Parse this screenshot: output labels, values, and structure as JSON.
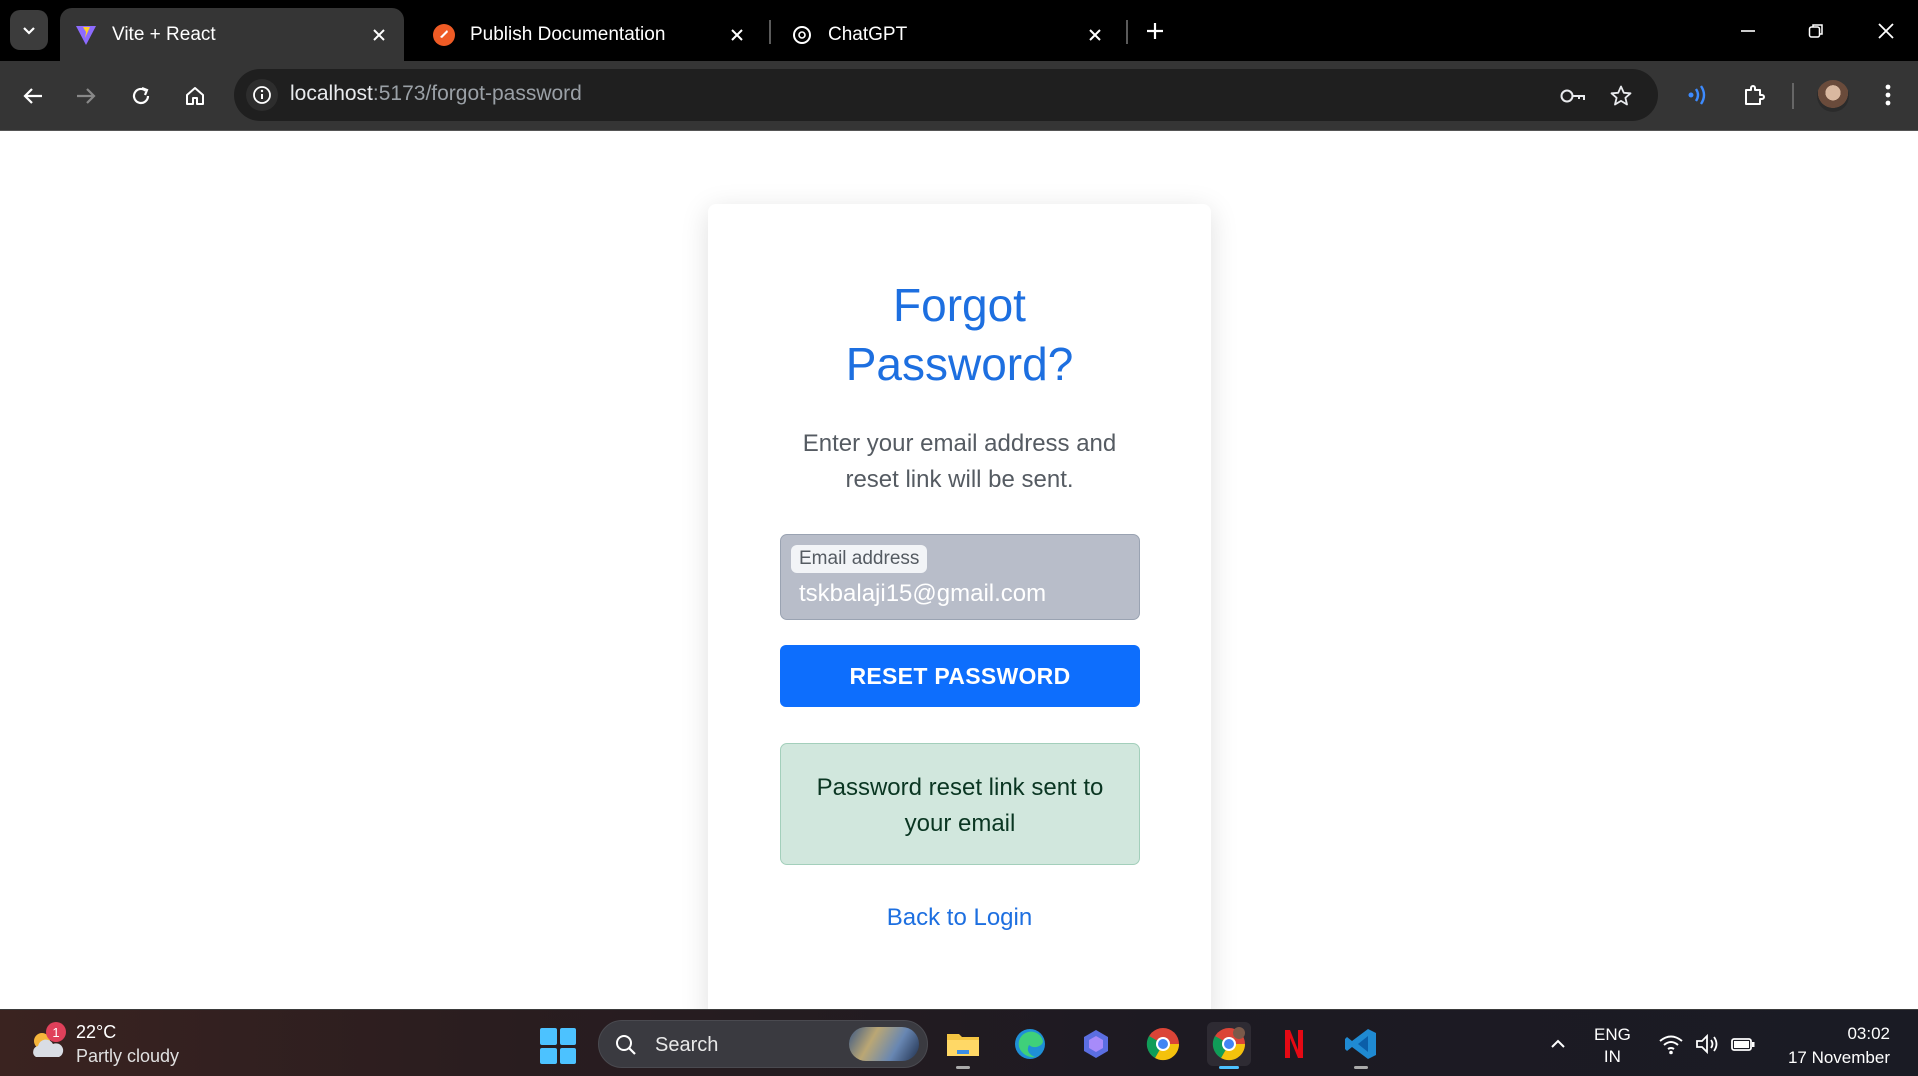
{
  "browser": {
    "tabs": [
      {
        "title": "Vite + React",
        "active": true,
        "icon": "vite-icon"
      },
      {
        "title": "Publish Documentation",
        "active": false,
        "icon": "postman-icon"
      },
      {
        "title": "ChatGPT",
        "active": false,
        "icon": "chatgpt-icon"
      }
    ],
    "address": {
      "host": "localhost",
      "rest": ":5173/forgot-password"
    }
  },
  "page": {
    "title_line1": "Forgot",
    "title_line2": "Password?",
    "subtitle": "Enter your email address and reset link will be sent.",
    "email_label": "Email address",
    "email_value": "tskbalaji15@gmail.com",
    "reset_button": "RESET PASSWORD",
    "success_message": "Password reset link sent to your email",
    "back_link": "Back to Login",
    "colors": {
      "primary": "#0d6efd",
      "heading": "#1d6fe0",
      "success_bg": "#d1e7dd",
      "success_text": "#0a3622"
    }
  },
  "taskbar": {
    "weather": {
      "badge": "1",
      "temp": "22°C",
      "condition": "Partly cloudy"
    },
    "search_placeholder": "Search",
    "apps": [
      "file-explorer-icon",
      "edge-icon",
      "copilot-icon",
      "chrome-icon",
      "chrome-profile-icon",
      "netflix-icon",
      "vscode-icon"
    ],
    "lang_line1": "ENG",
    "lang_line2": "IN",
    "time": "03:02",
    "date": "17 November"
  }
}
